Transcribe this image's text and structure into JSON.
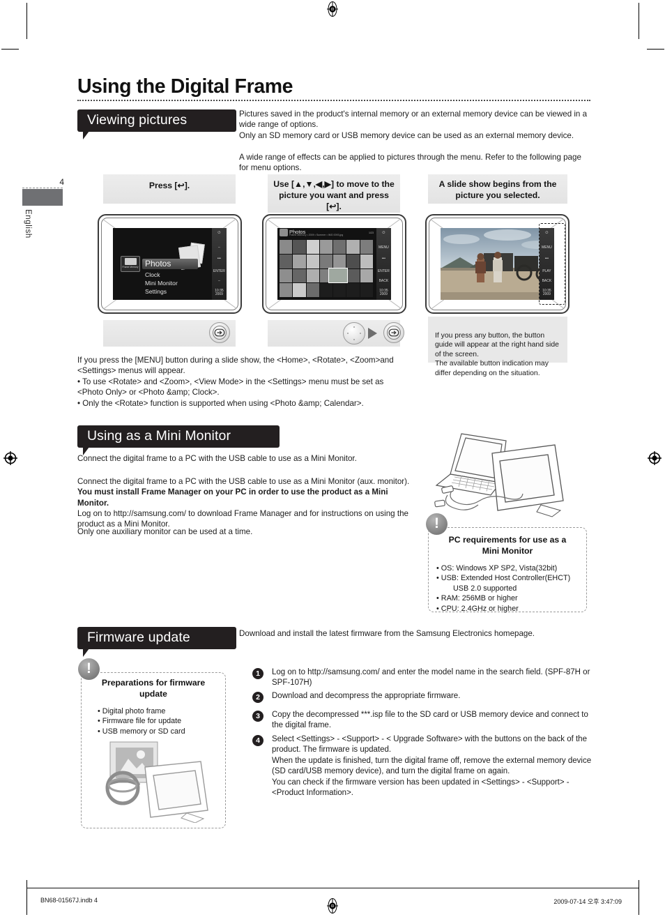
{
  "document": {
    "title": "Using the Digital Frame",
    "page_number": "4",
    "language_tab": "English"
  },
  "sections": {
    "viewing": {
      "heading": "Viewing pictures",
      "intro_lines": [
        "Pictures saved in the product's internal memory or an external memory device can be viewed in a wide range of options.",
        "Only an SD memory card or USB memory device can be used as an external memory device.",
        "A wide range of effects can be applied to pictures through the menu. Refer to the following page for menu options."
      ],
      "steps": [
        {
          "caption": "Press [↩]."
        },
        {
          "caption": "Use [▲,▼,◀,▶] to move to the picture you want and press [↩]."
        },
        {
          "caption": "A slide show begins from the picture you selected."
        }
      ],
      "screen_home": {
        "selected_item": "Photos",
        "items": [
          "Clock",
          "Mini Monitor",
          "Settings"
        ],
        "source_label": "Frame Memory"
      },
      "screen_grid": {
        "title": "Photos",
        "path": "Frame Memory • 2009 • Summer • IMG 0093.jpg",
        "counter": "1/23"
      },
      "note": "If you press any button, the button guide will appear at the right hand side of the screen.\nThe available button indication may differ depending on the situation.",
      "after_lines": [
        "If you press the [MENU] button during a slide show, the <Home>, <Rotate>, <Zoom>and <Settings> menus will appear.",
        "• To use <Rotate> and <Zoom>, <View Mode> in the <Settings> menu must be set as <Photo Only> or <Photo &amp; Clock>.",
        "• Only the <Rotate> function is supported when using <Photo &amp; Calendar>."
      ]
    },
    "mini_monitor": {
      "heading": "Using as a Mini Monitor",
      "lead": "Connect the digital frame to a PC with the USB cable to use as a Mini Monitor.",
      "body_plain_1": "Connect the digital frame to a PC with the USB cable to use as a Mini Monitor (aux. monitor). ",
      "body_bold": "You must install Frame Manager on your PC in order to use the product as a Mini Monitor.",
      "body_plain_2": "Log on to http://samsung.com/ to download Frame Manager and for instructions on using the product as a Mini Monitor.",
      "body_plain_3": "Only one auxiliary monitor can be used at a time.",
      "requirements": {
        "title": "PC requirements for use as a Mini Monitor",
        "items": [
          "• OS: Windows XP SP2, Vista(32bit)",
          "• USB: Extended Host Controller(EHCT)",
          "        USB 2.0 supported",
          "• RAM: 256MB or higher",
          "• CPU: 2.4GHz or higher"
        ]
      }
    },
    "firmware": {
      "heading": "Firmware update",
      "intro": "Download and install the latest firmware from the Samsung Electronics homepage.",
      "preparations": {
        "title": "Preparations for firmware update",
        "items": [
          "• Digital photo frame",
          "• Firmware file for update",
          "• USB memory or SD card"
        ]
      },
      "steps": [
        {
          "num": "1",
          "text": "Log on to http://samsung.com/ and enter the model name in the search field. (SPF-87H or SPF-107H)"
        },
        {
          "num": "2",
          "text": "Download and decompress the appropriate firmware."
        },
        {
          "num": "3",
          "text": "Copy the decompressed ***.isp file to the SD card or USB memory device and connect to the digital frame."
        },
        {
          "num": "4",
          "text": "Select <Settings> - <Support> - < Upgrade Software> with the buttons on the back of the product. The firmware is updated.\nWhen the update is finished, turn the digital frame off, remove the external memory device (SD card/USB memory device), and turn the digital frame on again.\nYou can check if the firmware version has been updated in <Settings> - <Support> - <Product Information>."
        }
      ]
    }
  },
  "footer": {
    "left": "BN68-01567J.indb   4",
    "right": "2009-07-14   오후 3:47:09"
  },
  "colors": {
    "callout_bg": "#231f20",
    "panel_bg": "#e9e9e9",
    "note_bg": "#e8e8e8",
    "lang_bar": "#6f7073"
  }
}
